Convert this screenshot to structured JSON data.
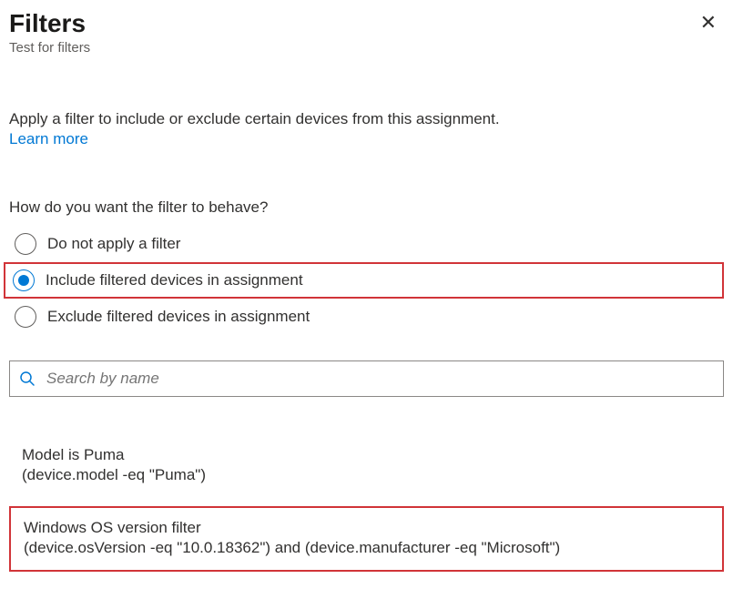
{
  "header": {
    "title": "Filters",
    "subtitle": "Test for filters"
  },
  "intro": {
    "text": "Apply a filter to include or exclude certain devices from this assignment.",
    "link": "Learn more"
  },
  "question": "How do you want the filter to behave?",
  "options": {
    "none": "Do not apply a filter",
    "include": "Include filtered devices in assignment",
    "exclude": "Exclude filtered devices in assignment",
    "selected": "include"
  },
  "search": {
    "placeholder": "Search by name"
  },
  "filters": [
    {
      "name": "Model is Puma",
      "query": "(device.model -eq \"Puma\")",
      "highlighted": false
    },
    {
      "name": "Windows OS version filter",
      "query": "(device.osVersion -eq \"10.0.18362\") and (device.manufacturer -eq \"Microsoft\")",
      "highlighted": true
    }
  ]
}
